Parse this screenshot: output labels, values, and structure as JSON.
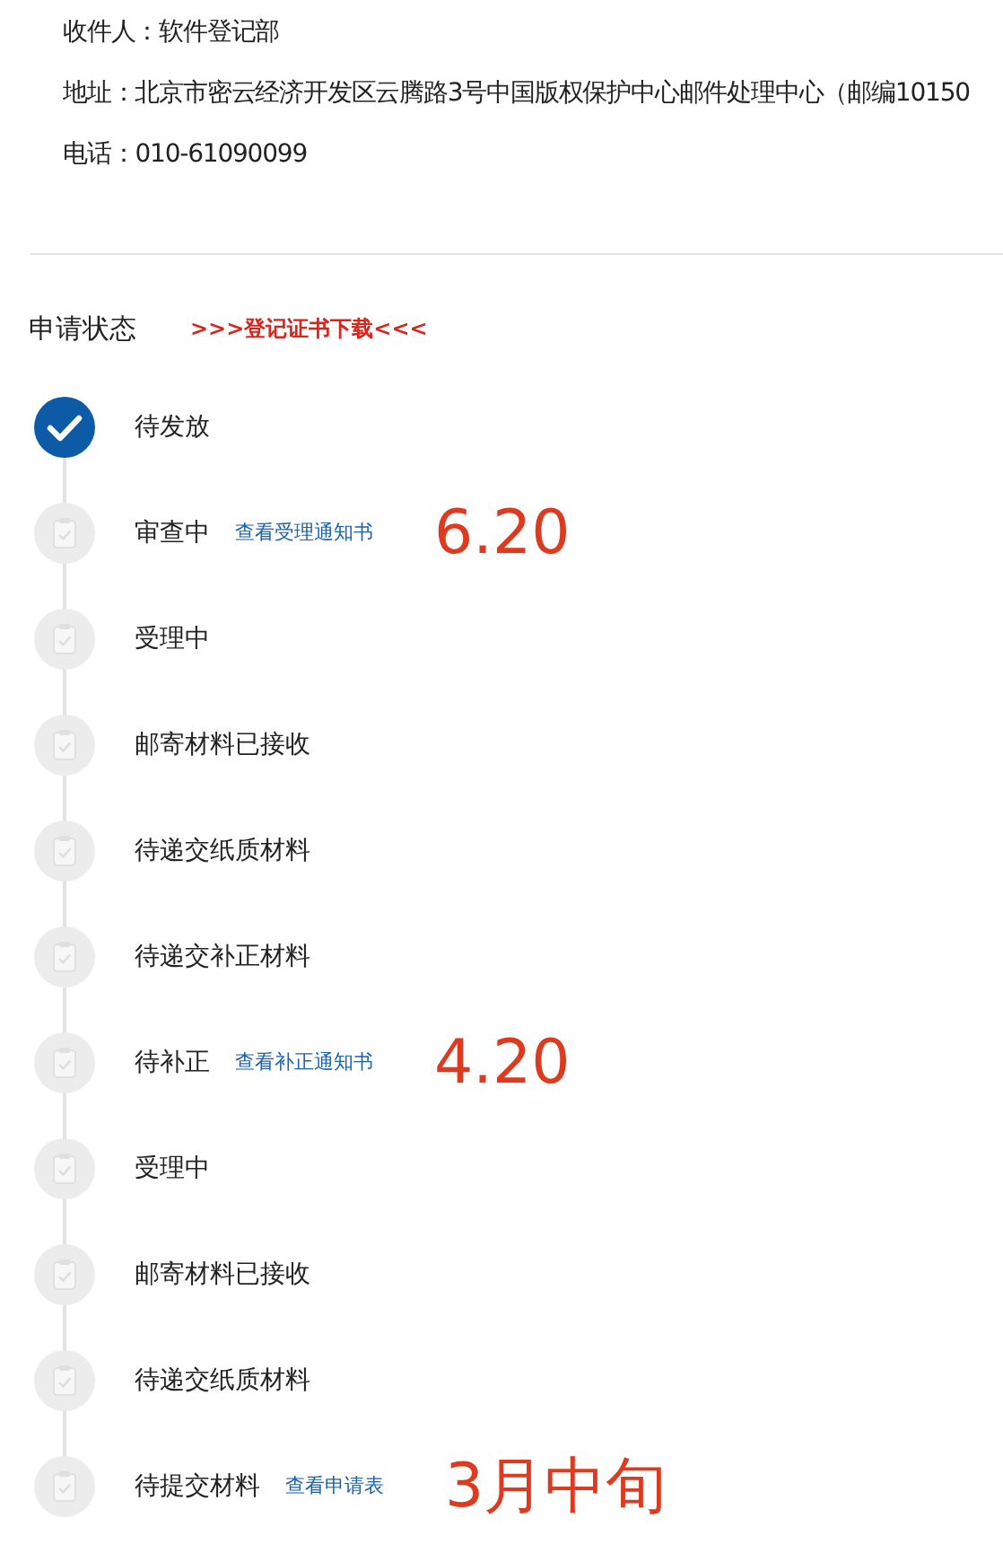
{
  "contact": [
    {
      "label": "收件人：",
      "value": "软件登记部"
    },
    {
      "label": "地址：",
      "value": "北京市密云经济开发区云腾路3号中国版权保护中心邮件处理中心（邮编10150"
    },
    {
      "label": "电话：",
      "value": "010-61090099"
    }
  ],
  "status": {
    "title": "申请状态",
    "download_link": ">>>登记证书下载<<<",
    "steps": [
      {
        "label": "待发放",
        "completed": true
      },
      {
        "label": "审查中",
        "completed": false,
        "link": "查看受理通知书",
        "annotation": "6.20"
      },
      {
        "label": "受理中",
        "completed": false
      },
      {
        "label": "邮寄材料已接收",
        "completed": false
      },
      {
        "label": "待递交纸质材料",
        "completed": false
      },
      {
        "label": "待递交补正材料",
        "completed": false
      },
      {
        "label": "待补正",
        "completed": false,
        "link": "查看补正通知书",
        "annotation": "4.20"
      },
      {
        "label": "受理中",
        "completed": false
      },
      {
        "label": "邮寄材料已接收",
        "completed": false
      },
      {
        "label": "待递交纸质材料",
        "completed": false
      },
      {
        "label": "待提交材料",
        "completed": false,
        "link": "查看申请表",
        "annotation": "3月中旬"
      }
    ]
  }
}
